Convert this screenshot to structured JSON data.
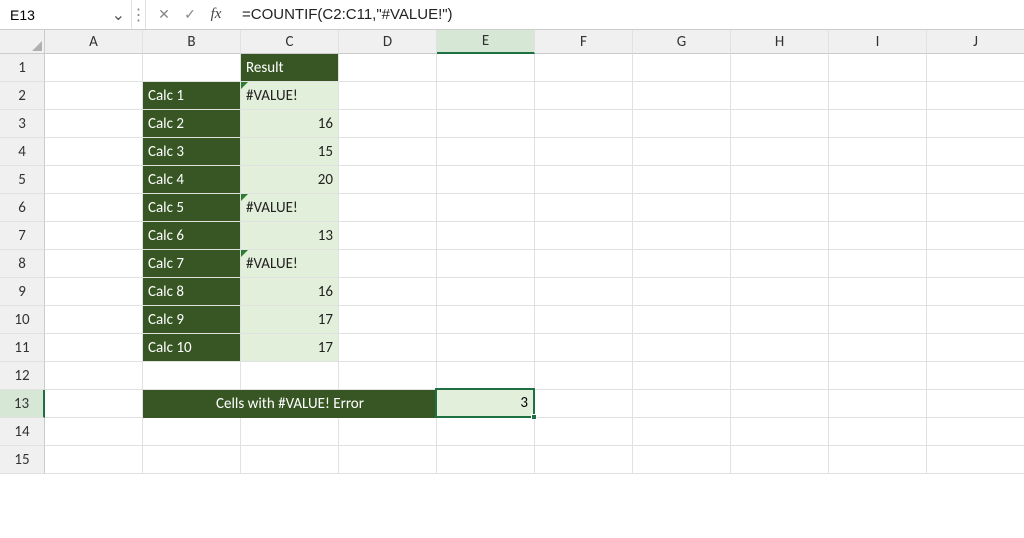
{
  "formula_bar": {
    "cell_reference": "E13",
    "formula": "=COUNTIF(C2:C11,\"#VALUE!\")",
    "cancel_icon": "✕",
    "accept_icon": "✓",
    "fx_label": "fx",
    "chevron": "⌄",
    "separator": "⋮"
  },
  "columns": [
    "A",
    "B",
    "C",
    "D",
    "E",
    "F",
    "G",
    "H",
    "I",
    "J"
  ],
  "rows": [
    "1",
    "2",
    "3",
    "4",
    "5",
    "6",
    "7",
    "8",
    "9",
    "10",
    "11",
    "12",
    "13",
    "14",
    "15"
  ],
  "table": {
    "header_result": "Result",
    "labels": [
      "Calc 1",
      "Calc 2",
      "Calc 3",
      "Calc 4",
      "Calc 5",
      "Calc 6",
      "Calc 7",
      "Calc 8",
      "Calc 9",
      "Calc 10"
    ],
    "values": [
      "#VALUE!",
      "16",
      "15",
      "20",
      "#VALUE!",
      "13",
      "#VALUE!",
      "16",
      "17",
      "17"
    ],
    "value_align": [
      "left",
      "right",
      "right",
      "right",
      "left",
      "right",
      "left",
      "right",
      "right",
      "right"
    ],
    "value_is_error": [
      true,
      false,
      false,
      false,
      true,
      false,
      true,
      false,
      false,
      false
    ]
  },
  "summary": {
    "label": "Cells with #VALUE! Error",
    "result": "3"
  },
  "chart_data": {
    "type": "table",
    "title": "Result",
    "categories": [
      "Calc 1",
      "Calc 2",
      "Calc 3",
      "Calc 4",
      "Calc 5",
      "Calc 6",
      "Calc 7",
      "Calc 8",
      "Calc 9",
      "Calc 10"
    ],
    "values": [
      "#VALUE!",
      16,
      15,
      20,
      "#VALUE!",
      13,
      "#VALUE!",
      16,
      17,
      17
    ],
    "summary": {
      "label": "Cells with #VALUE! Error",
      "value": 3
    }
  },
  "active_cell": {
    "col": "E",
    "row": 13
  }
}
